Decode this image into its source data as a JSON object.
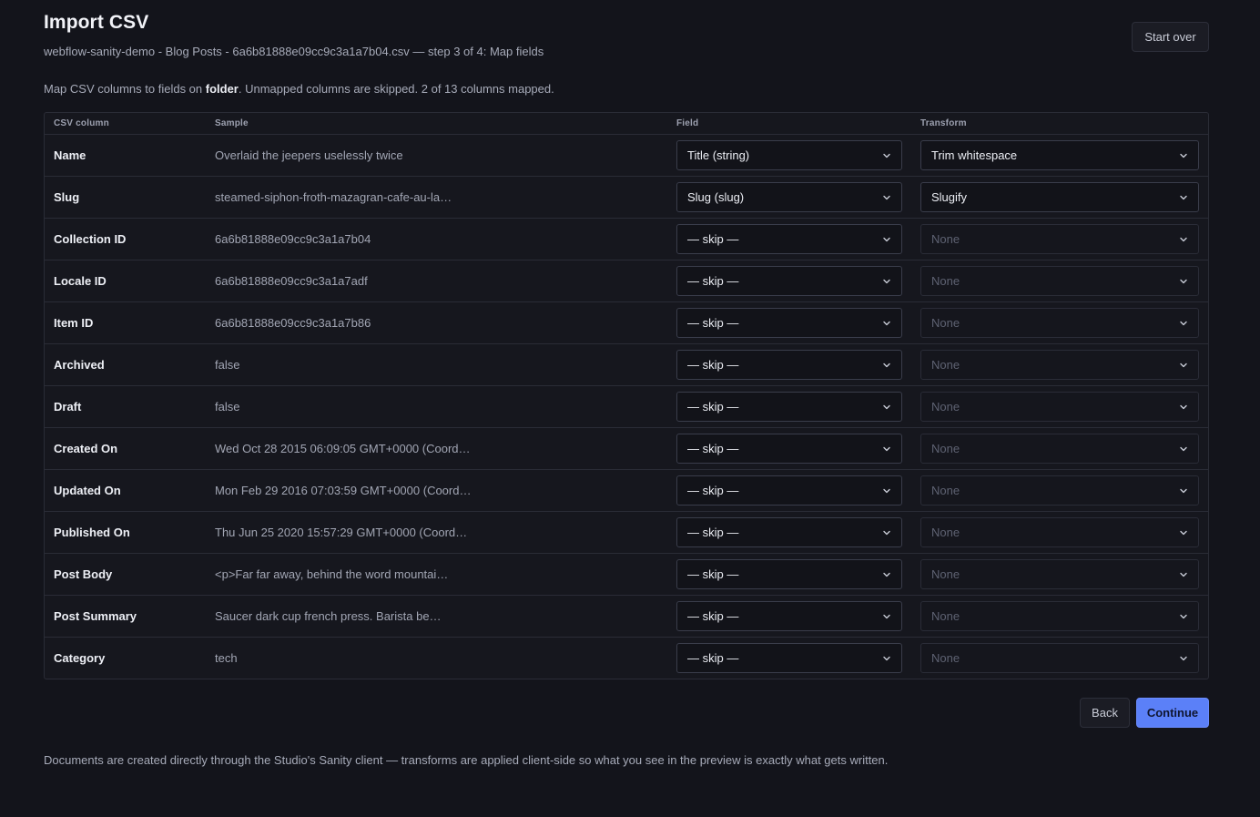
{
  "header": {
    "title": "Import CSV",
    "subtitle": "webflow-sanity-demo - Blog Posts - 6a6b81888e09cc9c3a1a7b04.csv — step 3 of 4: Map fields",
    "start_over_label": "Start over"
  },
  "intro": {
    "prefix": "Map CSV columns to fields on ",
    "doc_type": "folder",
    "suffix": ". Unmapped columns are skipped. 2 of 13 columns mapped."
  },
  "table": {
    "columns": {
      "csv_column": "CSV column",
      "sample": "Sample",
      "field": "Field",
      "transform": "Transform"
    },
    "rows": [
      {
        "name": "Name",
        "sample": "Overlaid the jeepers uselessly twice",
        "field": "Title (string)",
        "transform": "Trim whitespace",
        "transform_enabled": true
      },
      {
        "name": "Slug",
        "sample": "steamed-siphon-froth-mazagran-cafe-au-la…",
        "field": "Slug (slug)",
        "transform": "Slugify",
        "transform_enabled": true
      },
      {
        "name": "Collection ID",
        "sample": "6a6b81888e09cc9c3a1a7b04",
        "field": "— skip —",
        "transform": "None",
        "transform_enabled": false
      },
      {
        "name": "Locale ID",
        "sample": "6a6b81888e09cc9c3a1a7adf",
        "field": "— skip —",
        "transform": "None",
        "transform_enabled": false
      },
      {
        "name": "Item ID",
        "sample": "6a6b81888e09cc9c3a1a7b86",
        "field": "— skip —",
        "transform": "None",
        "transform_enabled": false
      },
      {
        "name": "Archived",
        "sample": "false",
        "field": "— skip —",
        "transform": "None",
        "transform_enabled": false
      },
      {
        "name": "Draft",
        "sample": "false",
        "field": "— skip —",
        "transform": "None",
        "transform_enabled": false
      },
      {
        "name": "Created On",
        "sample": "Wed Oct 28 2015 06:09:05 GMT+0000 (Coord…",
        "field": "— skip —",
        "transform": "None",
        "transform_enabled": false
      },
      {
        "name": "Updated On",
        "sample": "Mon Feb 29 2016 07:03:59 GMT+0000 (Coord…",
        "field": "— skip —",
        "transform": "None",
        "transform_enabled": false
      },
      {
        "name": "Published On",
        "sample": "Thu Jun 25 2020 15:57:29 GMT+0000 (Coord…",
        "field": "— skip —",
        "transform": "None",
        "transform_enabled": false
      },
      {
        "name": "Post Body",
        "sample": "<p>Far far away, behind the word mountai…",
        "field": "— skip —",
        "transform": "None",
        "transform_enabled": false
      },
      {
        "name": "Post Summary",
        "sample": "Saucer dark cup french press. Barista be…",
        "field": "— skip —",
        "transform": "None",
        "transform_enabled": false
      },
      {
        "name": "Category",
        "sample": "tech",
        "field": "— skip —",
        "transform": "None",
        "transform_enabled": false
      }
    ]
  },
  "actions": {
    "back_label": "Back",
    "continue_label": "Continue"
  },
  "footer": {
    "note": "Documents are created directly through the Studio's Sanity client — transforms are applied client-side so what you see in the preview is exactly what gets written."
  },
  "colors": {
    "background": "#13141b",
    "accent": "#5b80f8",
    "border": "#2a2c36"
  },
  "icons": {
    "select_chevron": "chevron-down-icon"
  }
}
